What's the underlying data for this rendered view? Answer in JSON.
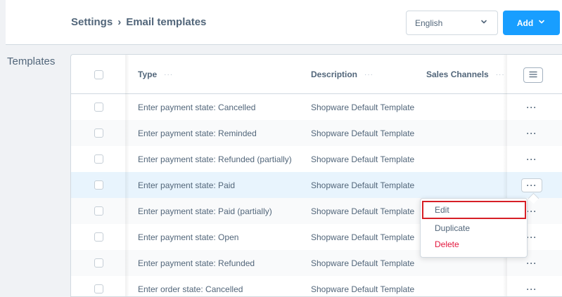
{
  "header": {
    "breadcrumb_root": "Settings",
    "breadcrumb_sep": "›",
    "breadcrumb_current": "Email templates",
    "language_value": "English",
    "add_label": "Add"
  },
  "sidebar": {
    "title": "Templates"
  },
  "table": {
    "columns": {
      "type": "Type",
      "description": "Description",
      "channels": "Sales Channels",
      "dots": "···"
    },
    "rows": [
      {
        "type": "Enter payment state: Cancelled",
        "description": "Shopware Default Template",
        "menu": "···"
      },
      {
        "type": "Enter payment state: Reminded",
        "description": "Shopware Default Template",
        "menu": "···"
      },
      {
        "type": "Enter payment state: Refunded (partially)",
        "description": "Shopware Default Template",
        "menu": "···"
      },
      {
        "type": "Enter payment state: Paid",
        "description": "Shopware Default Template",
        "menu": "···"
      },
      {
        "type": "Enter payment state: Paid (partially)",
        "description": "Shopware Default Template",
        "menu": "···"
      },
      {
        "type": "Enter payment state: Open",
        "description": "Shopware Default Template",
        "menu": "···"
      },
      {
        "type": "Enter payment state: Refunded",
        "description": "Shopware Default Template",
        "menu": "···"
      },
      {
        "type": "Enter order state: Cancelled",
        "description": "Shopware Default Template",
        "menu": "···"
      }
    ]
  },
  "context_menu": {
    "edit": "Edit",
    "duplicate": "Duplicate",
    "delete": "Delete"
  },
  "colors": {
    "accent": "#189eff",
    "danger": "#e3173d",
    "highlight": "#d71f26",
    "text": "#52667a"
  }
}
